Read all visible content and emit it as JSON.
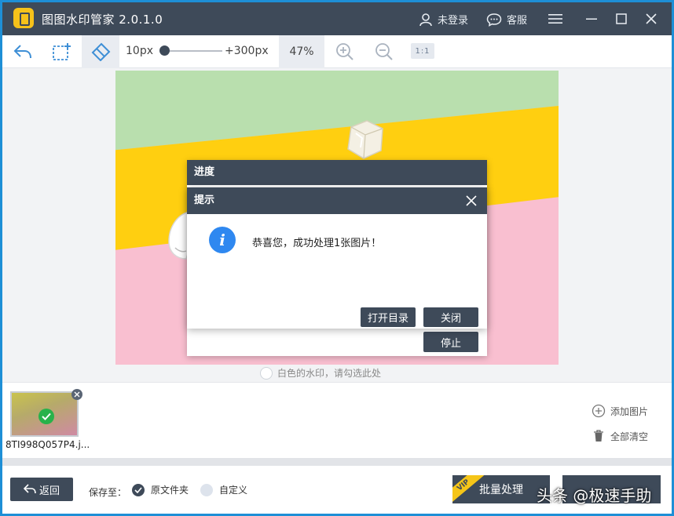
{
  "app": {
    "title": "图图水印管家  2.0.1.0",
    "user_label": "未登录",
    "service_label": "客服"
  },
  "toolbar": {
    "brush_min": "10px",
    "brush_max": "+300px",
    "brush_level": 0.0,
    "zoom": "47%",
    "ratio_label": "1:1"
  },
  "canvas": {
    "white_watermark_hint": "白色的水印，请勾选此处"
  },
  "thumbnails": [
    {
      "name": "8TI998Q057P4.j..."
    }
  ],
  "side_actions": {
    "add_images": "添加图片",
    "clear_all": "全部清空"
  },
  "bottom": {
    "back_label": "返回",
    "save_to_label": "保存至：",
    "option_original": "原文件夹",
    "option_custom": "自定义",
    "selected_option": "原文件夹",
    "vip_badge": "VIP",
    "batch_label": "批量处理",
    "overlay_watermark": "头条 @极速手助"
  },
  "progress_dialog": {
    "title": "进度",
    "stop_label": "停止"
  },
  "tip_dialog": {
    "title": "提示",
    "message": "恭喜您，成功处理1张图片！",
    "open_dir_label": "打开目录",
    "close_label": "关闭"
  },
  "colors": {
    "dark": "#3e4a59",
    "accent_blue": "#2f88f0",
    "success_green": "#27b24a",
    "vip_yellow": "#f5c518"
  }
}
